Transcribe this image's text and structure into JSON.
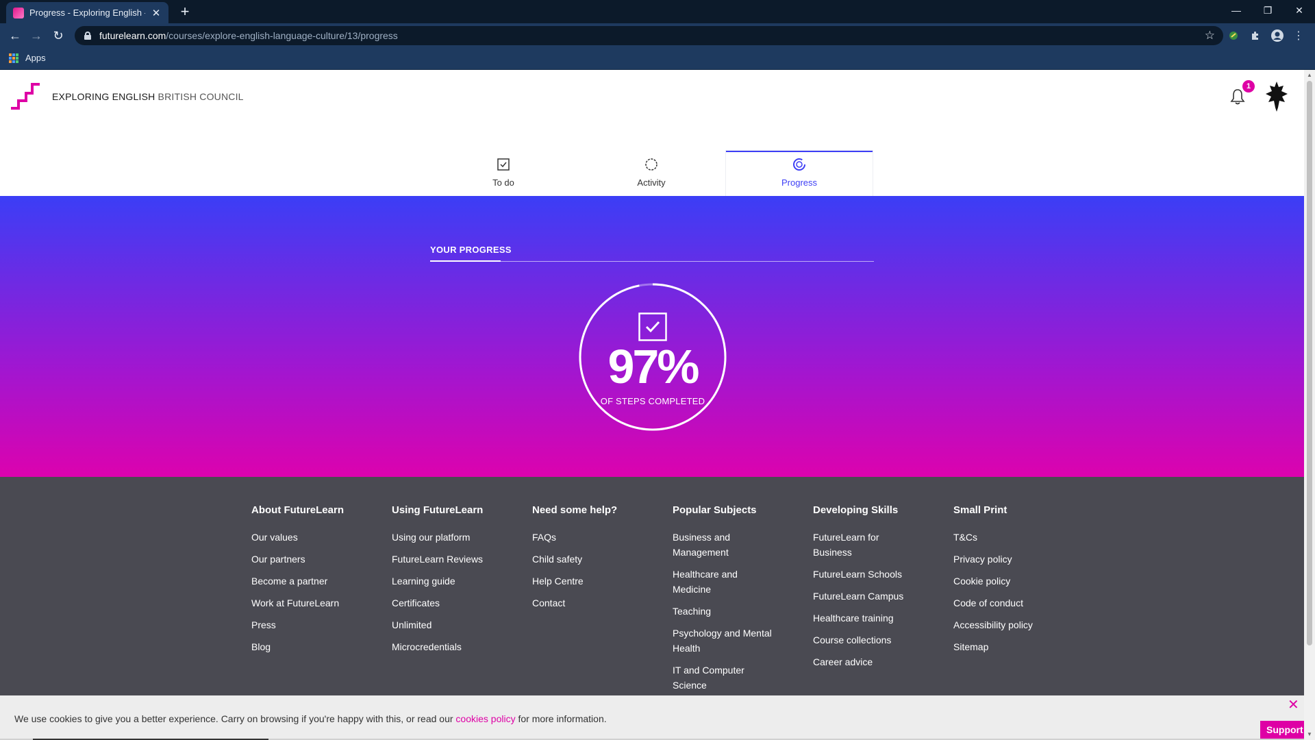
{
  "browser": {
    "tab_title": "Progress - Exploring English - British Council",
    "url_domain": "futurelearn.com",
    "url_path": "/courses/explore-english-language-culture/13/progress",
    "bookmarks": {
      "apps_label": "Apps"
    }
  },
  "header": {
    "course_name": "EXPLORING ENGLISH",
    "partner_name": "BRITISH COUNCIL",
    "notification_count": "1"
  },
  "tabs": [
    {
      "label": "To do",
      "icon": "checkbox-icon",
      "active": false
    },
    {
      "label": "Activity",
      "icon": "activity-ring-icon",
      "active": false
    },
    {
      "label": "Progress",
      "icon": "progress-ring-icon",
      "active": true
    }
  ],
  "progress": {
    "heading": "YOUR PROGRESS",
    "value": "97%",
    "fraction": 0.97,
    "caption": "OF STEPS COMPLETED"
  },
  "footer": {
    "columns": [
      {
        "title": "About FutureLearn",
        "links": [
          "Our values",
          "Our partners",
          "Become a partner",
          "Work at FutureLearn",
          "Press",
          "Blog"
        ]
      },
      {
        "title": "Using FutureLearn",
        "links": [
          "Using our platform",
          "FutureLearn Reviews",
          "Learning guide",
          "Certificates",
          "Unlimited",
          "Microcredentials"
        ]
      },
      {
        "title": "Need some help?",
        "links": [
          "FAQs",
          "Child safety",
          "Help Centre",
          "Contact"
        ]
      },
      {
        "title": "Popular Subjects",
        "links": [
          "Business and Management",
          "Healthcare and Medicine",
          "Teaching",
          "Psychology and Mental Health",
          "IT and Computer Science"
        ]
      },
      {
        "title": "Developing Skills",
        "links": [
          "FutureLearn for Business",
          "FutureLearn Schools",
          "FutureLearn Campus",
          "Healthcare training",
          "Course collections",
          "Career advice"
        ]
      },
      {
        "title": "Small Print",
        "links": [
          "T&Cs",
          "Privacy policy",
          "Cookie policy",
          "Code of conduct",
          "Accessibility policy",
          "Sitemap"
        ]
      }
    ]
  },
  "cookie_banner": {
    "text_before": "We use cookies to give you a better experience. Carry on browsing if you're happy with this, or read our ",
    "link_text": "cookies policy",
    "text_after": " for more information."
  },
  "support": {
    "label": "Support"
  },
  "colors": {
    "brand_pink": "#de00a5",
    "brand_blue": "#3d3ef5",
    "footer_bg": "#4a4a52"
  }
}
